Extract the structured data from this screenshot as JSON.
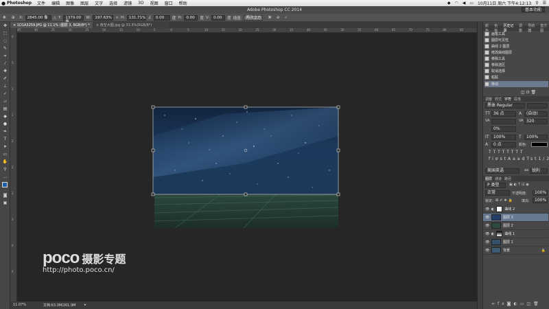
{
  "menubar": {
    "apple": "",
    "app": "Photoshop",
    "items": [
      "文件",
      "编辑",
      "图像",
      "图层",
      "文字",
      "选择",
      "滤镜",
      "3D",
      "视图",
      "窗口",
      "帮助"
    ],
    "clock": "10月11日 周六 下午4:12:13"
  },
  "window": {
    "title": "Adobe Photoshop CC 2014",
    "workspace": "基本功能"
  },
  "options": {
    "x_label": "X:",
    "x_value": "2845.00 像",
    "y_label": "Y:",
    "y_value": "1379.00 像",
    "w_label": "W:",
    "w_value": "197.63%",
    "h_label": "H:",
    "h_value": "131.71%",
    "angle_value": "0.00",
    "angle_unit": "度",
    "hskew_label": "H:",
    "hskew_value": "0.00",
    "hskew_unit": "度",
    "vskew_label": "V:",
    "vskew_value": "0.00",
    "vskew_unit": "度",
    "interp_label": "插值:",
    "interp_value": "两次立方"
  },
  "tabs": [
    {
      "label": "1D1A3259.JPG @ 11.1% (图层 3, RGB/8*) *",
      "active": true
    },
    {
      "label": "夜空大图.jpg @ 33.3%(RGB/8*)",
      "active": false
    }
  ],
  "ruler_top": [
    "45",
    "40",
    "35",
    "30",
    "25",
    "20",
    "15",
    "10",
    "5",
    "0",
    "5",
    "10",
    "15",
    "20",
    "25",
    "30",
    "35",
    "40",
    "45",
    "50",
    "55",
    "60",
    "65",
    "70",
    "75",
    "80",
    "85"
  ],
  "ruler_left": [
    "0",
    "5",
    "1",
    "1",
    "2",
    "2",
    "3",
    "3",
    "4",
    "4"
  ],
  "status": {
    "zoom": "11.07%",
    "doc": "文档:63.3M/201.9M"
  },
  "watermark": {
    "brand": "poco",
    "title": "摄影专题",
    "url": "http://photo.poco.cn/"
  },
  "history": {
    "tabs": [
      "颜色",
      "色板",
      "历史记录",
      "调整",
      "导航器",
      "直方图"
    ],
    "items": [
      {
        "label": "画笔工具",
        "selected": false
      },
      {
        "label": "图层可见性",
        "selected": false
      },
      {
        "label": "曲线 2 图层",
        "selected": false
      },
      {
        "label": "修改曲线图层",
        "selected": false
      },
      {
        "label": "移除工具",
        "selected": false
      },
      {
        "label": "移除选区",
        "selected": false
      },
      {
        "label": "取消选择",
        "selected": false
      },
      {
        "label": "粘贴",
        "selected": false
      },
      {
        "label": "移动",
        "selected": true
      }
    ]
  },
  "character": {
    "tabs": [
      "调整",
      "样式",
      "字符",
      "段落"
    ],
    "font_family": "黑体 Regular",
    "font_size": "36 点",
    "leading": "(自动)",
    "kerning": "VA",
    "tracking": "320",
    "scale_pct": "0%",
    "vscale": "100%",
    "hscale": "100%",
    "baseline": "0 点",
    "color_label": "颜色:",
    "language": "美国英语",
    "aa_label": "aa",
    "aa_value": "锐利"
  },
  "layers": {
    "tabs": [
      "图层",
      "通道",
      "路径"
    ],
    "filter_label": "P 类型",
    "blend_mode": "正常",
    "opacity_label": "不透明度:",
    "opacity": "100%",
    "lock_label": "锁定:",
    "fill_label": "填充:",
    "fill": "100%",
    "items": [
      {
        "name": "曲线 2",
        "kind": "curves",
        "selected": false
      },
      {
        "name": "图层 3",
        "kind": "image",
        "selected": true
      },
      {
        "name": "图层 2",
        "kind": "image",
        "selected": false
      },
      {
        "name": "曲线 1",
        "kind": "curves",
        "selected": false
      },
      {
        "name": "图层 1",
        "kind": "image",
        "selected": false
      },
      {
        "name": "背景",
        "kind": "image",
        "selected": false
      }
    ]
  },
  "colors": {
    "accent_selection": "#677891",
    "panel": "#474747"
  }
}
